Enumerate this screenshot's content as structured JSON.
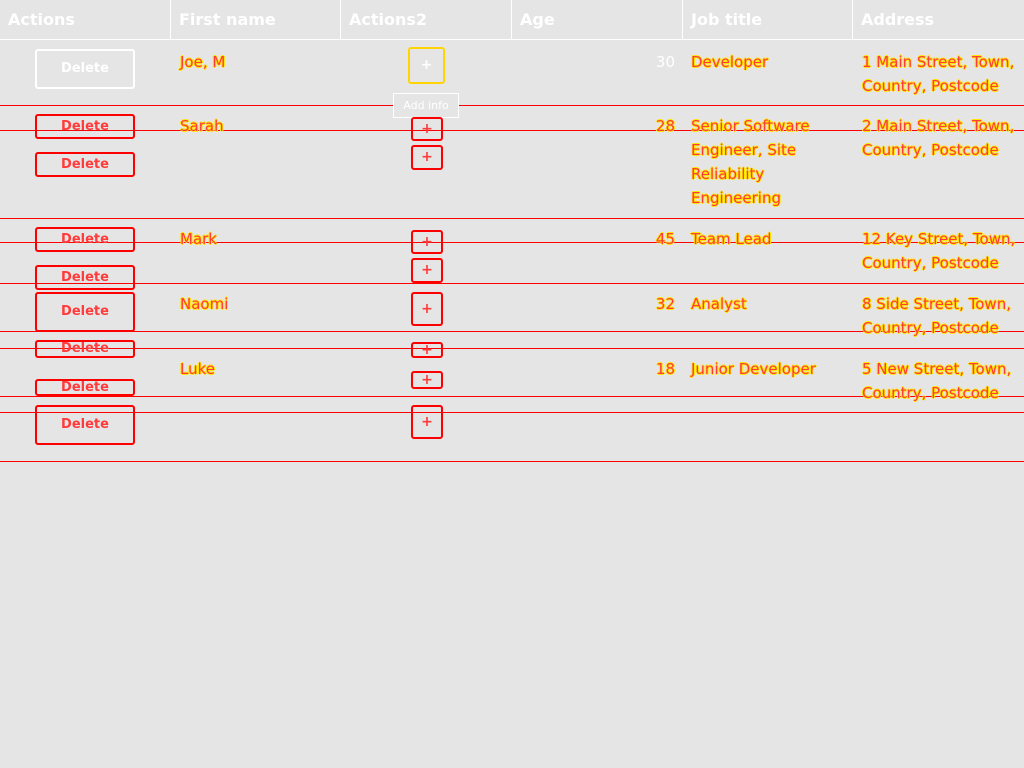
{
  "table": {
    "columns": [
      "Actions",
      "First name",
      "Actions2",
      "Age",
      "Job title",
      "Address"
    ]
  },
  "tooltip": "Add info",
  "actions": {
    "delete": "Delete",
    "add": "+"
  },
  "rows": [
    {
      "first_name": "Joe, M",
      "age": "30",
      "job_title": "Developer",
      "address": "1 Main Street, Town,\nCountry, Postcode"
    },
    {
      "first_name": "Sarah",
      "age": "28",
      "job_title": "Senior Software\nEngineer, Site\nReliability\nEngineering",
      "address": "2 Main Street, Town,\nCountry, Postcode"
    },
    {
      "first_name": "Mark",
      "age": "45",
      "job_title": "Team Lead",
      "address": "12 Key Street, Town,\nCountry, Postcode"
    },
    {
      "first_name": "Naomi",
      "age": "32",
      "job_title": "Analyst",
      "address": "8 Side Street, Town,\nCountry, Postcode"
    },
    {
      "first_name": "Luke",
      "age": "18",
      "job_title": "Junior Developer",
      "address": "5 New Street, Town,\nCountry, Postcode"
    }
  ]
}
